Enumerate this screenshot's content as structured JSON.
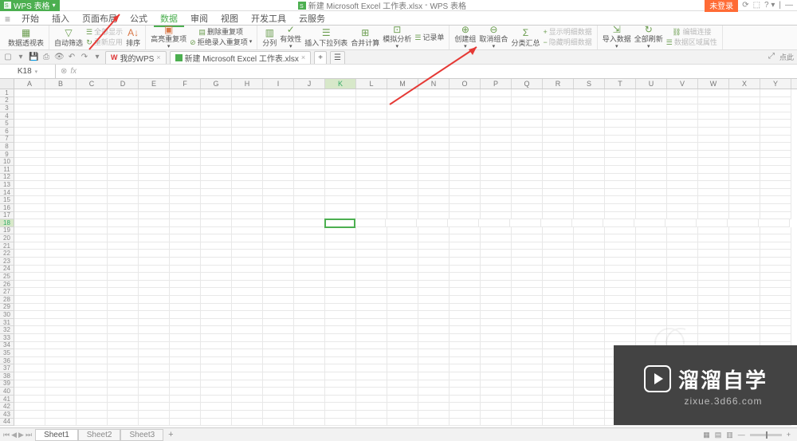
{
  "title": {
    "app": "WPS 表格",
    "doc_icon": "S",
    "filename": "新建 Microsoft Excel 工作表.xlsx",
    "suffix": "WPS 表格"
  },
  "window": {
    "login": "未登录",
    "icons": [
      "⟳",
      "⬚",
      "?",
      "—",
      "—"
    ]
  },
  "menu": {
    "items": [
      "开始",
      "插入",
      "页面布局",
      "公式",
      "数据",
      "审阅",
      "视图",
      "开发工具",
      "云服务"
    ],
    "active_index": 4
  },
  "ribbon": {
    "pivot": "数据透视表",
    "autofilter": "自动筛选",
    "show_all": "全部显示",
    "reapply": "重新应用",
    "sort": "排序",
    "highlight_dup": "高亮重复项",
    "del_dup": "删除重复项",
    "reject_dup": "拒绝录入重复项",
    "text_to_col": "分列",
    "validity": "有效性",
    "insert_dropdown": "插入下拉列表",
    "consolidate": "合并计算",
    "whatif": "模拟分析",
    "record_sheet": "记录单",
    "group": "创建组",
    "ungroup": "取消组合",
    "subtotal": "分类汇总",
    "show_detail": "显示明细数据",
    "hide_detail": "隐藏明细数据",
    "import": "导入数据",
    "refresh_all": "全部刷新",
    "edit_conn": "编辑连接",
    "data_props": "数据区域属性"
  },
  "doctabs": {
    "mywps": "我的WPS",
    "file": "新建 Microsoft Excel 工作表.xlsx"
  },
  "qa_right": "点此",
  "formula": {
    "namebox": "K18",
    "fx": "fx"
  },
  "grid": {
    "cols": [
      "A",
      "B",
      "C",
      "D",
      "E",
      "F",
      "G",
      "H",
      "I",
      "J",
      "K",
      "L",
      "M",
      "N",
      "O",
      "P",
      "Q",
      "R",
      "S",
      "T",
      "U",
      "V",
      "W",
      "X",
      "Y"
    ],
    "row_count": 44,
    "active": {
      "row": 18,
      "col": "K"
    }
  },
  "sheets": {
    "tabs": [
      "Sheet1",
      "Sheet2",
      "Sheet3"
    ],
    "active_index": 0
  },
  "watermark": {
    "cn": "溜溜自学",
    "url": "zixue.3d66.com"
  }
}
